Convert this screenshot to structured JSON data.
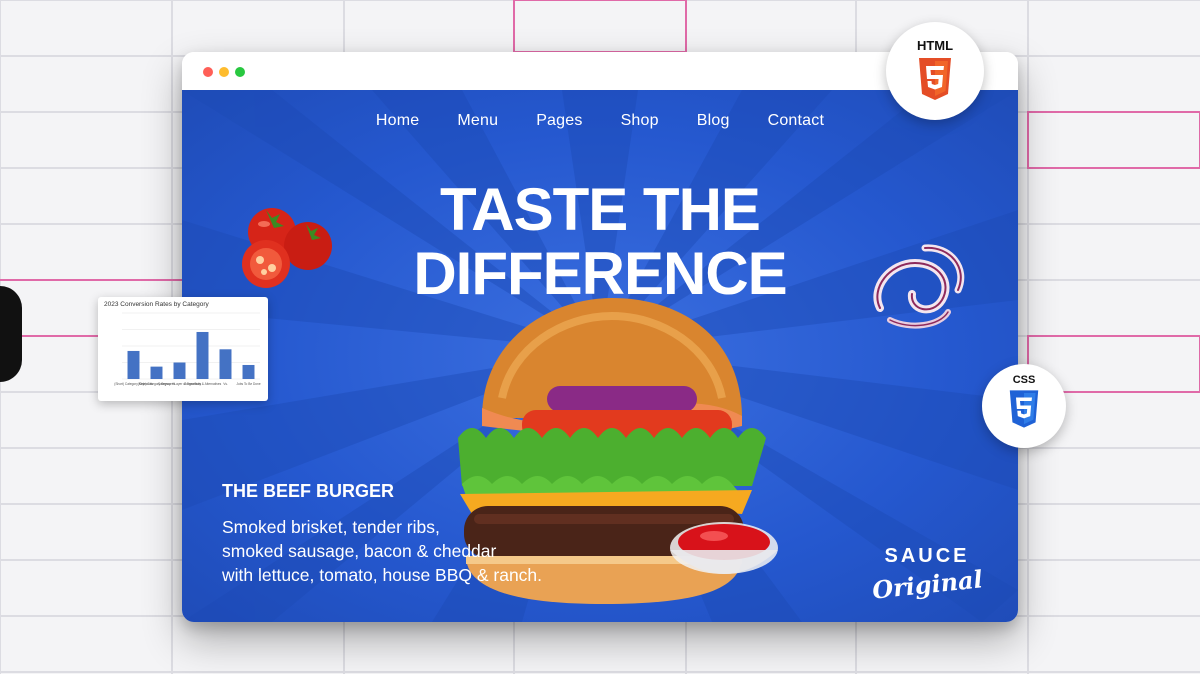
{
  "nav": {
    "items": [
      {
        "label": "Home"
      },
      {
        "label": "Menu"
      },
      {
        "label": "Pages"
      },
      {
        "label": "Shop"
      },
      {
        "label": "Blog"
      },
      {
        "label": "Contact"
      }
    ]
  },
  "hero": {
    "headline_line1": "TASTE THE",
    "headline_line2": "DIFFERENCE"
  },
  "product": {
    "title": "THE BEEF BURGER",
    "description_lines": [
      "Smoked brisket, tender ribs,",
      "smoked sausage, bacon & cheddar",
      "with lettuce, tomato, house BBQ & ranch."
    ]
  },
  "sauce_logo": {
    "line1": "SAUCE",
    "line2": "Original"
  },
  "badges": {
    "html_label": "HTML",
    "html_icon": "html5-icon",
    "css_label": "CSS",
    "css_icon": "css3-icon"
  },
  "colors": {
    "hero_blue": "#2558cf",
    "html_orange": "#e44d26",
    "css_blue": "#1f62d6"
  },
  "chart_card": {
    "title": "2023 Conversion Rates by Category",
    "chart_data": {
      "type": "bar",
      "title": "2023 Conversion Rates by Category",
      "categories": [
        "(Short) Category Keywords",
        "(Side) Category Keywords",
        "Category + Layer of Specificity",
        "Comparison & Alternatives",
        "Vs.",
        "Jobs To Be Done"
      ],
      "values": [
        3.4,
        1.5,
        2.0,
        5.7,
        3.6,
        1.7
      ],
      "ylim": [
        0,
        8
      ]
    }
  }
}
